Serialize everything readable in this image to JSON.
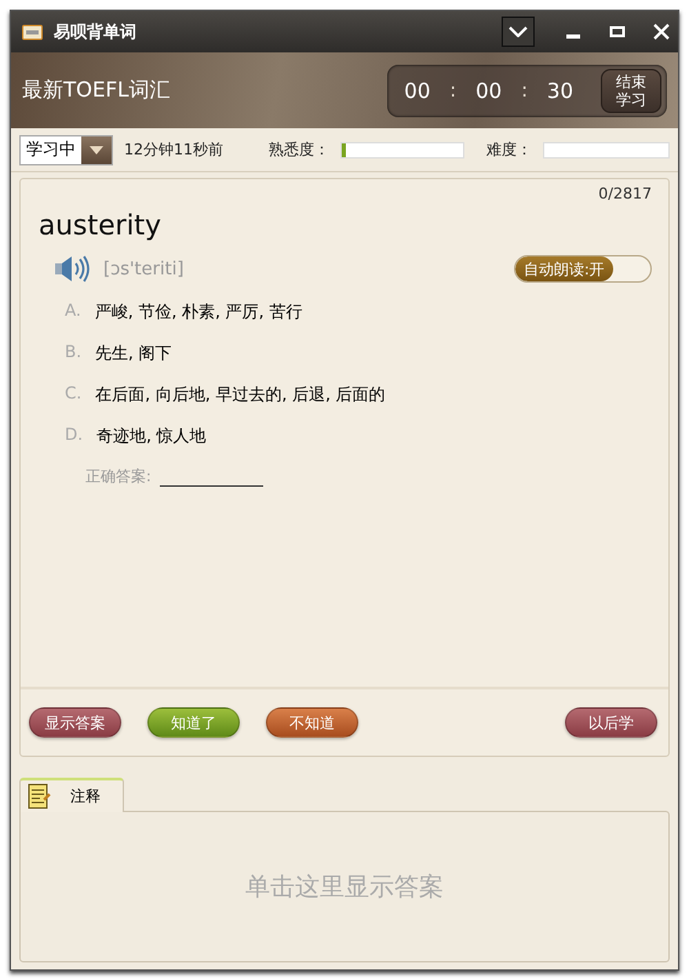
{
  "window": {
    "title": "易呗背单词"
  },
  "header": {
    "deck_title": "最新TOEFL词汇",
    "timer": [
      {
        "kind": "digits",
        "text": "00"
      },
      {
        "kind": "separator",
        "text": ":"
      },
      {
        "kind": "digits",
        "text": "00"
      },
      {
        "kind": "separator",
        "text": ":"
      },
      {
        "kind": "digits",
        "text": "30"
      }
    ],
    "end_button": "结束学习"
  },
  "toolbar": {
    "status": "学习中",
    "time_ago": "12分钟11秒前",
    "familiarity": {
      "label": "熟悉度：",
      "level": 0.03
    },
    "difficulty": {
      "label": "难度：",
      "level": 0
    }
  },
  "card": {
    "counter": "0/2817",
    "word": "austerity",
    "phonetic": "[ɔs'teriti]",
    "auto_read": {
      "label": "自动朗读:开",
      "on": true
    },
    "options": [
      {
        "letter": "A.",
        "text": "严峻, 节俭, 朴素, 严厉, 苦行"
      },
      {
        "letter": "B.",
        "text": "先生, 阁下"
      },
      {
        "letter": "C.",
        "text": "在后面, 向后地, 早过去的, 后退, 后面的"
      },
      {
        "letter": "D.",
        "text": "奇迹地, 惊人地"
      }
    ],
    "answer_label": "正确答案:",
    "buttons": [
      {
        "kind": "show",
        "label": "显示答案"
      },
      {
        "kind": "know",
        "label": "知道了"
      },
      {
        "kind": "unknown",
        "label": "不知道"
      },
      {
        "kind": "later",
        "label": "以后学"
      }
    ]
  },
  "tabs": [
    {
      "label": "注释",
      "selected": true
    }
  ],
  "notes": {
    "text": "单击这里显示答案"
  }
}
